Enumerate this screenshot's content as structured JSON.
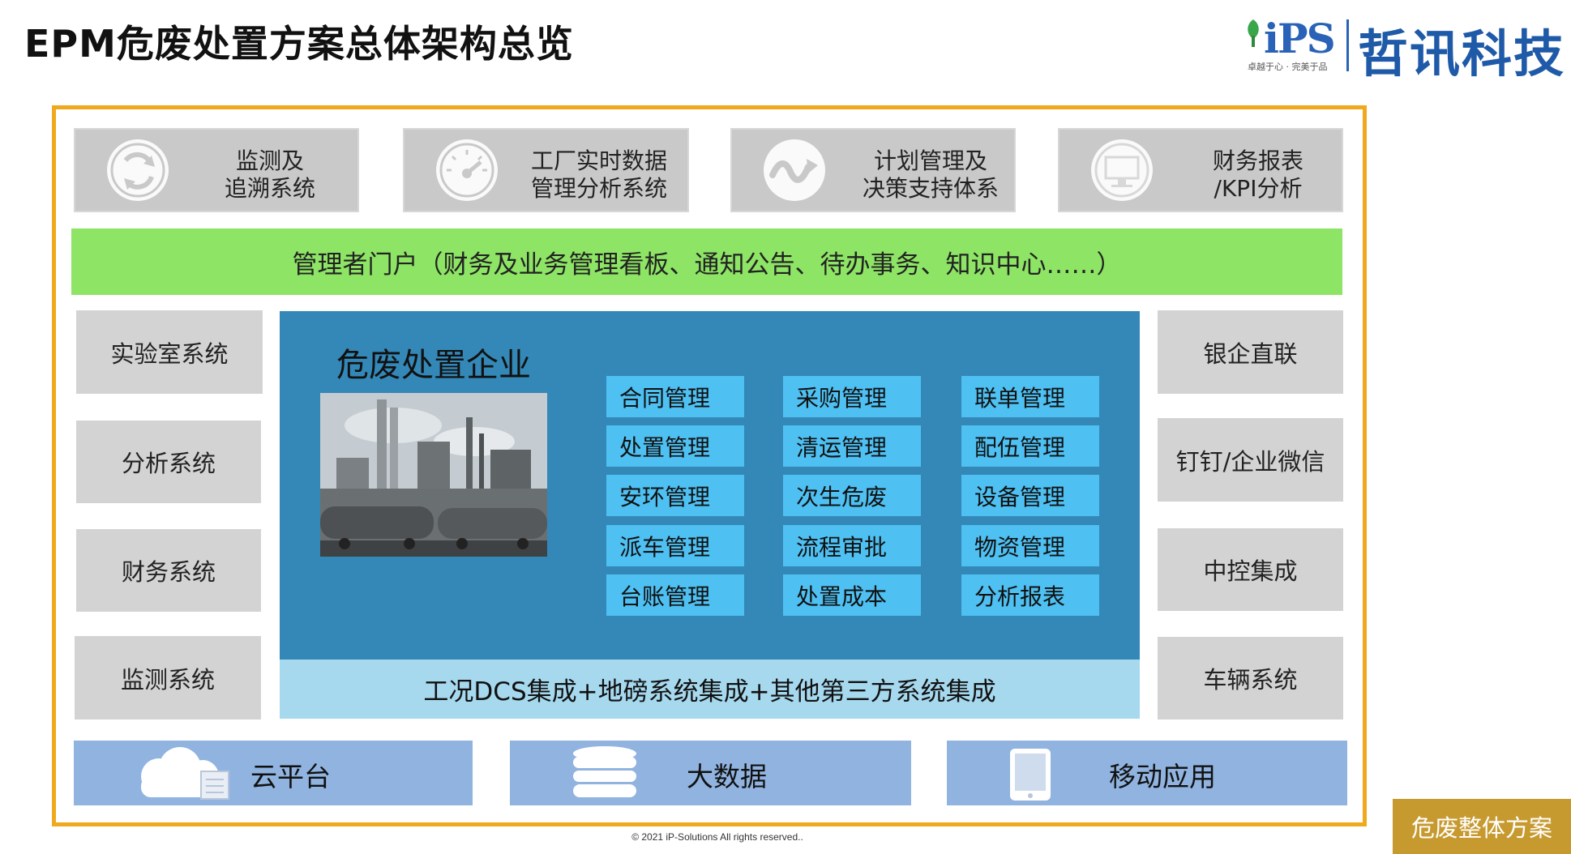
{
  "title": "EPM危废处置方案总体架构总览",
  "logo": {
    "brand": "iPS",
    "company": "哲讯科技",
    "slogan": "卓越于心 · 完美于品"
  },
  "top_systems": [
    {
      "label": "监测及\n追溯系统",
      "icon": "recycle-arrows-icon"
    },
    {
      "label": "工厂实时数据\n管理分析系统",
      "icon": "speedometer-icon"
    },
    {
      "label": "计划管理及\n决策支持体系",
      "icon": "wave-arrow-icon"
    },
    {
      "label": "财务报表\n/KPI分析",
      "icon": "monitor-icon"
    }
  ],
  "portal": "管理者门户（财务及业务管理看板、通知公告、待办事务、知识中心……）",
  "left_systems": [
    "实验室系统",
    "分析系统",
    "财务系统",
    "监测系统"
  ],
  "right_systems": [
    "银企直联",
    "钉钉/企业微信",
    "中控集成",
    "车辆系统"
  ],
  "core": {
    "title": "危废处置企业",
    "image": "industrial-plant-photo",
    "modules": [
      [
        "合同管理",
        "采购管理",
        "联单管理"
      ],
      [
        "处置管理",
        "清运管理",
        "配伍管理"
      ],
      [
        "安环管理",
        "次生危废",
        "设备管理"
      ],
      [
        "派车管理",
        "流程审批",
        "物资管理"
      ],
      [
        "台账管理",
        "处置成本",
        "分析报表"
      ]
    ]
  },
  "integration": "工况DCS集成+地磅系统集成+其他第三方系统集成",
  "infrastructure": [
    {
      "label": "云平台",
      "icon": "cloud-icon"
    },
    {
      "label": "大数据",
      "icon": "database-icon"
    },
    {
      "label": "移动应用",
      "icon": "tablet-icon"
    }
  ],
  "copyright": "© 2021  iP-Solutions All rights reserved..",
  "corner_tag": "危废整体方案",
  "colors": {
    "frame": "#f0a91c",
    "portal": "#8de465",
    "core": "#3488b7",
    "module": "#4ec0f2",
    "integration": "#a6d8ee",
    "infrastructure": "#90b3e0",
    "side_box": "#d3d3d3",
    "tag": "#c79a30"
  }
}
